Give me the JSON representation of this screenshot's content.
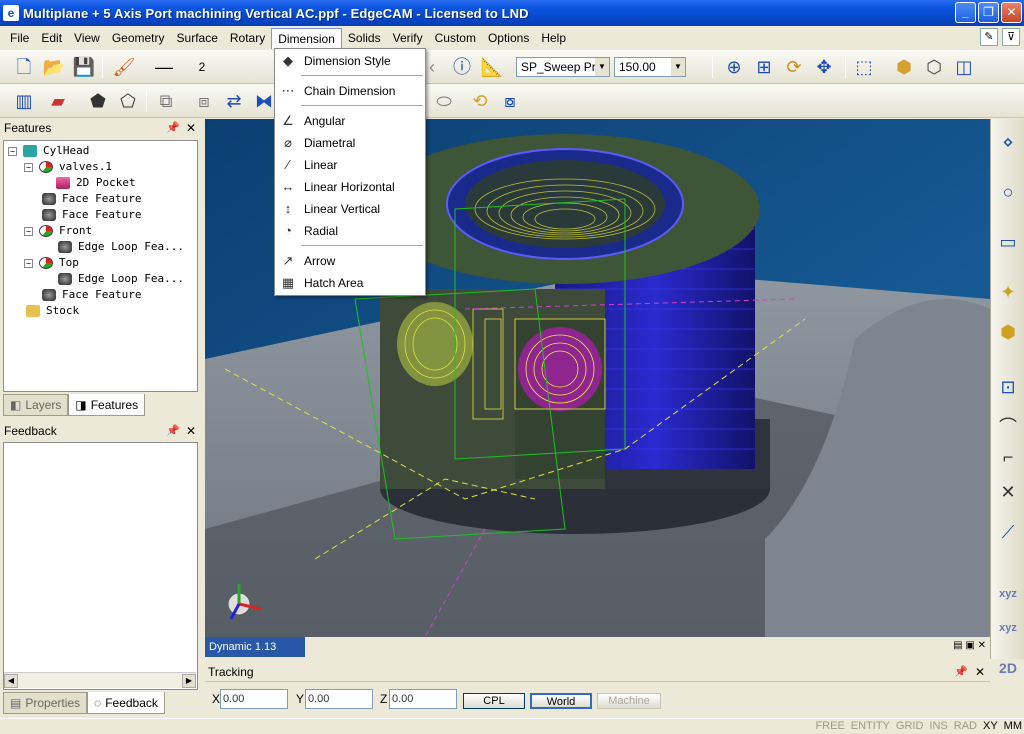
{
  "window": {
    "title": "Multiplane + 5 Axis Port machining Vertical AC.ppf - EdgeCAM - Licensed to LND",
    "icon": "e"
  },
  "menubar": [
    "File",
    "Edit",
    "View",
    "Geometry",
    "Surface",
    "Rotary",
    "Dimension",
    "Solids",
    "Verify",
    "Custom",
    "Options",
    "Help"
  ],
  "toolbar": {
    "line_width_value": "2",
    "operation_combo": "SP_Sweep Prof",
    "value_combo": "150.00"
  },
  "features_panel": {
    "title": "Features",
    "tree": [
      {
        "label": "CylHead",
        "level": 0,
        "toggle": "−",
        "icon": "cyl"
      },
      {
        "label": "valves.1",
        "level": 1,
        "toggle": "−",
        "icon": "pie"
      },
      {
        "label": "2D Pocket",
        "level": 2,
        "toggle": "",
        "icon": "pocket"
      },
      {
        "label": "Face Feature",
        "level": 2,
        "toggle": "",
        "icon": "face"
      },
      {
        "label": "Face Feature",
        "level": 2,
        "toggle": "",
        "icon": "face"
      },
      {
        "label": "Front",
        "level": 1,
        "toggle": "−",
        "icon": "pie"
      },
      {
        "label": "Edge Loop Fea...",
        "level": 2,
        "toggle": "",
        "icon": "face"
      },
      {
        "label": "Top",
        "level": 1,
        "toggle": "−",
        "icon": "pie"
      },
      {
        "label": "Edge Loop Fea...",
        "level": 2,
        "toggle": "",
        "icon": "face"
      },
      {
        "label": "Face Feature",
        "level": 2,
        "toggle": "",
        "icon": "face"
      },
      {
        "label": "Stock",
        "level": 1,
        "toggle": "",
        "icon": "stock"
      }
    ],
    "tabs": [
      "Layers",
      "Features"
    ]
  },
  "feedback_panel": {
    "title": "Feedback",
    "tabs": [
      "Properties",
      "Feedback"
    ]
  },
  "viewport": {
    "label": "Dynamic 1.13"
  },
  "dimension_menu": {
    "items": [
      {
        "label": "Dimension Style",
        "icon": "dimension-style-icon",
        "glyph": "◆"
      },
      {
        "label": "Chain Dimension",
        "icon": "chain-dimension-icon",
        "glyph": "⋯"
      },
      {
        "label": "Angular",
        "icon": "angular-icon",
        "glyph": "∠"
      },
      {
        "label": "Diametral",
        "icon": "diametral-icon",
        "glyph": "⌀"
      },
      {
        "label": "Linear",
        "icon": "linear-icon",
        "glyph": "⁄"
      },
      {
        "label": "Linear Horizontal",
        "icon": "linear-horizontal-icon",
        "glyph": "↔"
      },
      {
        "label": "Linear Vertical",
        "icon": "linear-vertical-icon",
        "glyph": "↕"
      },
      {
        "label": "Radial",
        "icon": "radial-icon",
        "glyph": "◔"
      },
      {
        "label": "Arrow",
        "icon": "arrow-icon",
        "glyph": "↗"
      },
      {
        "label": "Hatch Area",
        "icon": "hatch-area-icon",
        "glyph": "▦"
      }
    ]
  },
  "tracking": {
    "title": "Tracking",
    "x_label": "X",
    "x_value": "0.00",
    "y_label": "Y",
    "y_value": "0.00",
    "z_label": "Z",
    "z_value": "0.00",
    "buttons": [
      "CPL",
      "World",
      "Machine"
    ]
  },
  "statusbar": [
    "FREE",
    "ENTITY",
    "GRID",
    "INS",
    "RAD",
    "XY",
    "MM"
  ],
  "palette_labels": [
    "xyz",
    "xyz",
    "2D"
  ],
  "colors": {
    "title_blue": "#0a55e0",
    "viewport_bg": "#0e4f86",
    "label_blue": "#2957a8"
  }
}
